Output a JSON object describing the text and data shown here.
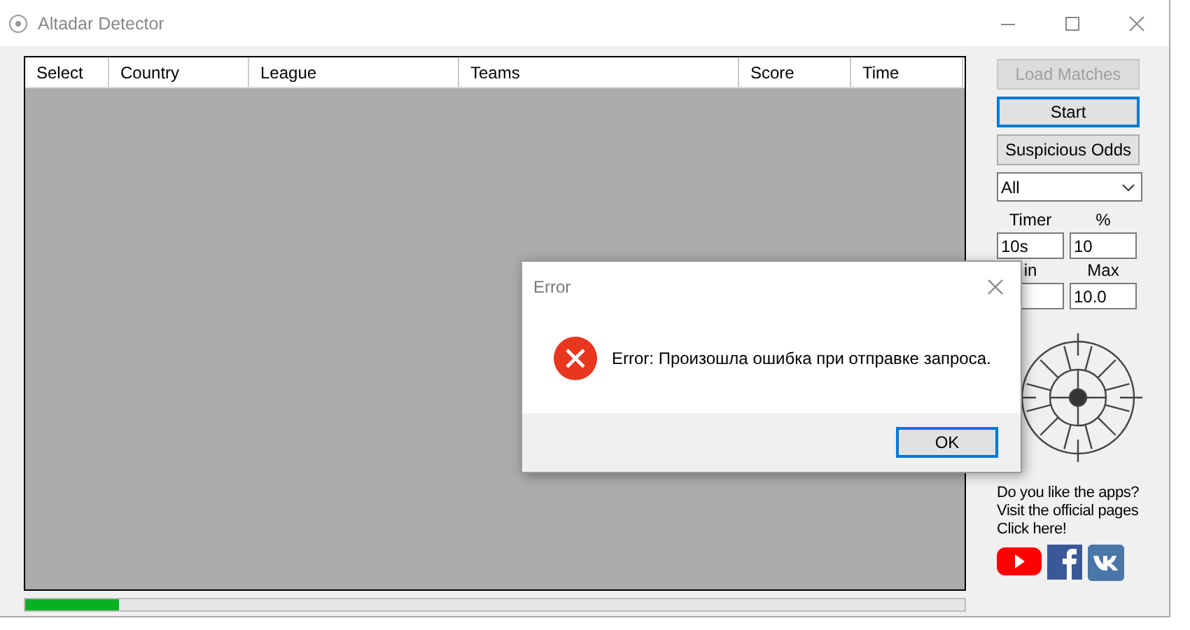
{
  "window": {
    "title": "Altadar Detector"
  },
  "table": {
    "columns": [
      "Select",
      "Country",
      "League",
      "Teams",
      "Score",
      "Time"
    ]
  },
  "progress": {
    "level": 0.1
  },
  "sidebar": {
    "buttons": [
      {
        "label": "Load Matches",
        "disabled": true,
        "focused": false
      },
      {
        "label": "Start",
        "disabled": false,
        "focused": true
      },
      {
        "label": "Suspicious Odds",
        "disabled": false,
        "focused": false
      }
    ],
    "filter": {
      "value": "All"
    },
    "fields": [
      {
        "label": "Timer",
        "value": "10s"
      },
      {
        "label": "%",
        "value": "10"
      },
      {
        "label": "in"
      },
      {
        "label": "Max",
        "value": "10.0"
      }
    ],
    "promo": {
      "lines": [
        "Do you like the apps?",
        "Visit the official pages"
      ],
      "link": "Click here!"
    }
  },
  "dialog": {
    "title": "Error",
    "message": "Error: Произошла ошибка при отправке запроса.",
    "button": "OK"
  }
}
